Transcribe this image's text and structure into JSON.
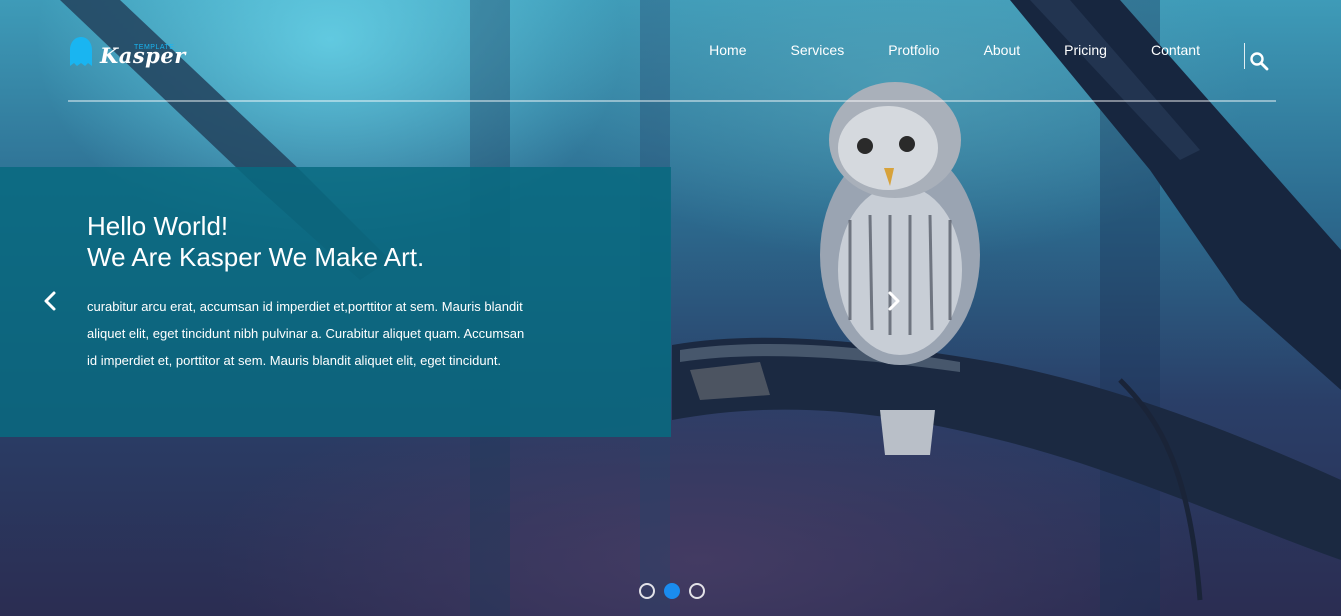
{
  "brand": {
    "name": "Kasper",
    "tagline": "TEMPLATE",
    "accent_color": "#19b5f1"
  },
  "nav": {
    "items": [
      "Home",
      "Services",
      "Protfolio",
      "About",
      "Pricing",
      "Contant"
    ],
    "search_icon": "search-icon"
  },
  "hero": {
    "title_line1": "Hello World!",
    "title_line2": "We Are Kasper We Make Art.",
    "body": "curabitur arcu erat, accumsan id imperdiet et,porttitor at sem. Mauris blandit aliquet elit, eget tincidunt nibh pulvinar a. Curabitur aliquet quam. Accumsan id imperdiet et, porttitor at sem. Mauris blandit aliquet elit, eget tincidunt.",
    "panel_color": "#086a80"
  },
  "slider": {
    "prev_icon": "chevron-left-icon",
    "next_icon": "chevron-right-icon",
    "slide_count": 3,
    "active_index": 1,
    "active_color": "#1a8cef"
  }
}
